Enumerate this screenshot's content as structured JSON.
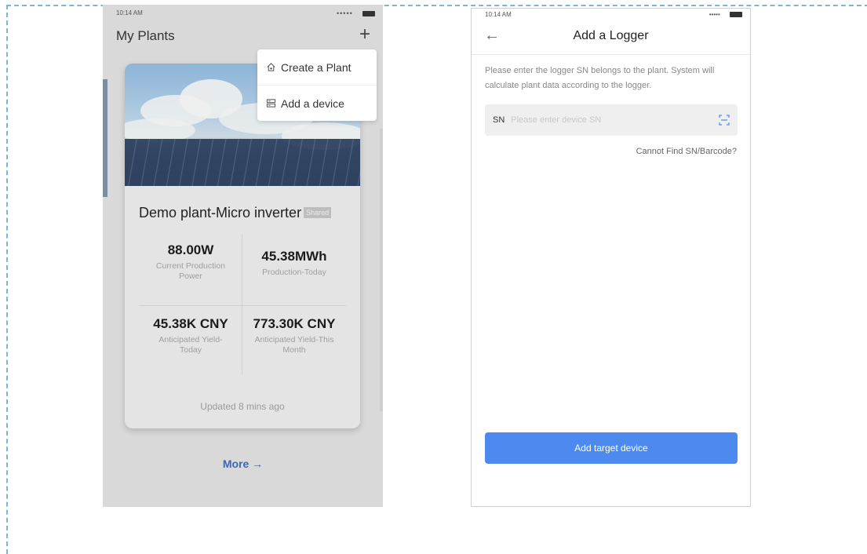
{
  "left_screen": {
    "status": {
      "time": "10:14 AM",
      "signal": "•••••"
    },
    "title": "My Plants",
    "menu": {
      "items": [
        {
          "label": "Create a Plant",
          "icon": "house-plus-icon"
        },
        {
          "label": "Add a device",
          "icon": "device-icon"
        }
      ]
    },
    "card": {
      "name": "Demo plant-Micro inverter",
      "badge": "Shared",
      "stats": [
        {
          "value": "88.00W",
          "label": "Current Production Power"
        },
        {
          "value": "45.38MWh",
          "label": "Production-Today"
        },
        {
          "value": "45.38K CNY",
          "label": "Anticipated Yield-Today"
        },
        {
          "value": "773.30K CNY",
          "label": "Anticipated Yield-This Month"
        }
      ],
      "updated": "Updated 8 mins ago"
    },
    "more_label": "More →"
  },
  "right_screen": {
    "status": {
      "time": "10:14 AM",
      "signal": "•••••"
    },
    "title": "Add a Logger",
    "description": "Please enter the logger SN belongs to the plant. System will calculate plant data according to the logger.",
    "sn_label": "SN",
    "sn_placeholder": "Please enter device SN",
    "sn_value": "",
    "cannot_find": "Cannot Find SN/Barcode?",
    "submit_label": "Add target device"
  },
  "colors": {
    "accent": "#4d8af0",
    "link": "#3a67b8",
    "frame_dash": "#7fb4d4"
  }
}
